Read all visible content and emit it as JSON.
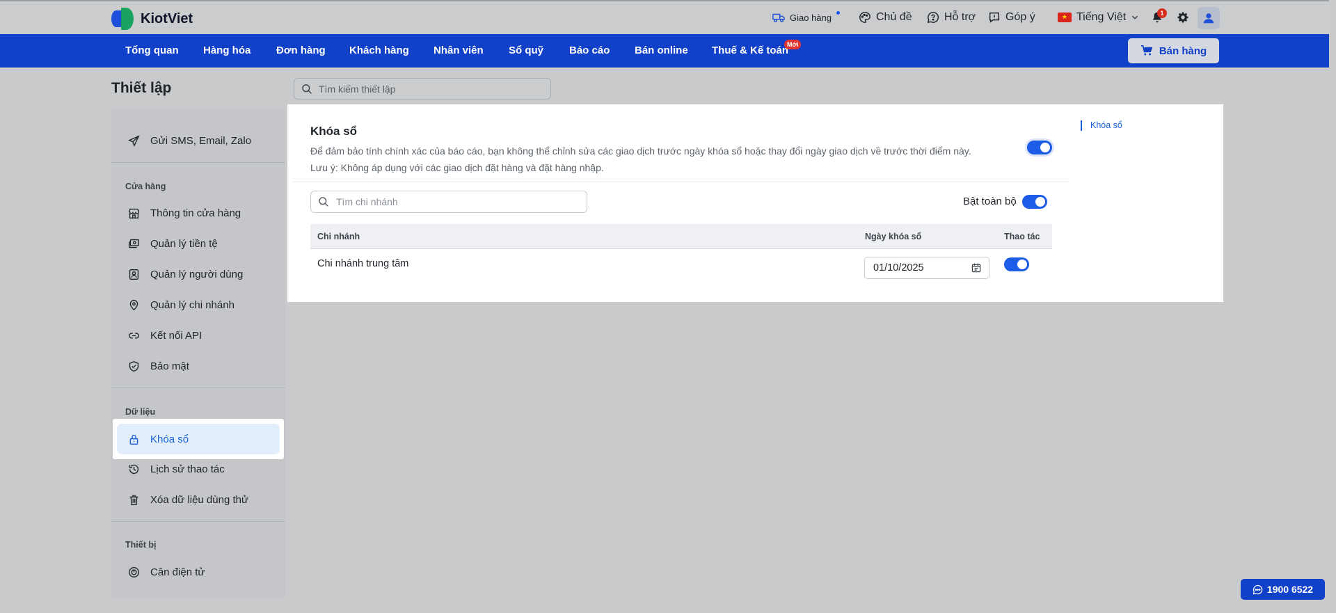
{
  "brand": {
    "name": "KiotViet"
  },
  "header": {
    "delivery": "Giao hàng",
    "theme": "Chủ đề",
    "support": "Hỗ trợ",
    "feedback": "Góp ý",
    "language": "Tiếng Việt",
    "notification_count": "1"
  },
  "nav": {
    "items": [
      "Tổng quan",
      "Hàng hóa",
      "Đơn hàng",
      "Khách hàng",
      "Nhân viên",
      "Sổ quỹ",
      "Báo cáo",
      "Bán online",
      "Thuế & Kế toán"
    ],
    "new_badge": "Mới",
    "sell_button": "Bán hàng"
  },
  "page": {
    "title": "Thiết lập",
    "search_placeholder": "Tìm kiếm thiết lập"
  },
  "sidebar": {
    "top_item": "Gửi SMS, Email, Zalo",
    "store_heading": "Cửa hàng",
    "store_items": [
      "Thông tin cửa hàng",
      "Quản lý tiền tệ",
      "Quản lý người dùng",
      "Quản lý chi nhánh",
      "Kết nối API",
      "Bảo mật"
    ],
    "data_heading": "Dữ liệu",
    "data_items": [
      "Khóa sổ",
      "Lịch sử thao tác",
      "Xóa dữ liệu dùng thử"
    ],
    "device_heading": "Thiết bị",
    "device_items": [
      "Cân điện tử"
    ]
  },
  "lock_books": {
    "title": "Khóa sổ",
    "description": "Để đảm bảo tính chính xác của báo cáo, bạn không thể chỉnh sửa các giao dịch trước ngày khóa sổ hoặc thay đổi ngày giao dịch về trước thời điểm này.",
    "note": "Lưu ý: Không áp dụng với các giao dịch đặt hàng và đặt hàng nhập.",
    "enabled": true,
    "branch_search_placeholder": "Tìm chi nhánh",
    "enable_all_label": "Bật toàn bộ",
    "table": {
      "headers": [
        "Chi nhánh",
        "Ngày khóa sổ",
        "Thao tác"
      ],
      "rows": [
        {
          "branch": "Chi nhánh trung tâm",
          "date": "01/10/2025",
          "enabled": true
        }
      ]
    }
  },
  "anchor_nav": {
    "label": "Khóa sổ"
  },
  "hotline": "1900 6522",
  "colors": {
    "primary": "#1140c9",
    "accent": "#1560d9",
    "toggle": "#1d5ce6",
    "success": "#1aa260",
    "danger": "#d92d20"
  }
}
